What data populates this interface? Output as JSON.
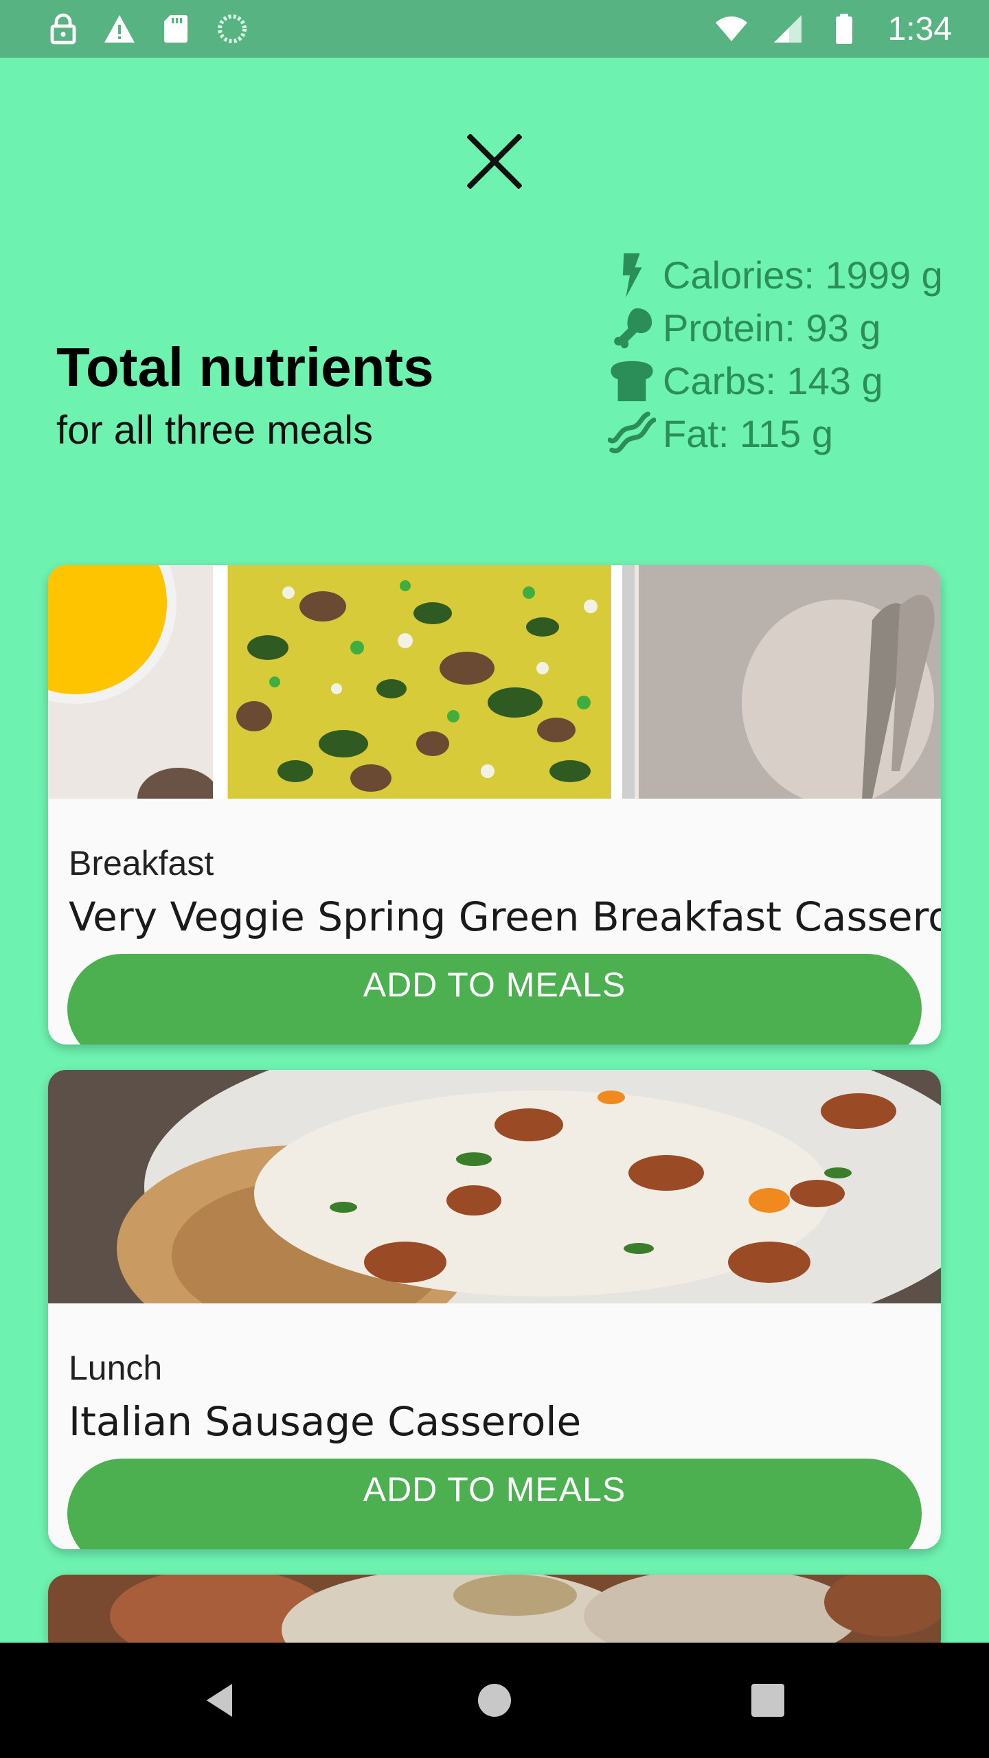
{
  "status_bar": {
    "time": "1:34",
    "left_icons": [
      "lock-icon",
      "warning-icon",
      "sd-card-icon",
      "sync-icon"
    ],
    "right_icons": [
      "wifi-icon",
      "signal-icon",
      "battery-icon"
    ]
  },
  "summary": {
    "title": "Total nutrients",
    "subtitle": "for all three meals",
    "nutrients": [
      {
        "icon": "lightning-icon",
        "text": "Calories: 1999 g"
      },
      {
        "icon": "drumstick-icon",
        "text": "Protein: 93 g"
      },
      {
        "icon": "bread-icon",
        "text": "Carbs: 143 g"
      },
      {
        "icon": "bacon-icon",
        "text": "Fat: 115 g"
      }
    ]
  },
  "meals": [
    {
      "label": "Breakfast",
      "title": "Very Veggie Spring Green Breakfast Casserole",
      "button": "ADD TO MEALS"
    },
    {
      "label": "Lunch",
      "title": "Italian Sausage Casserole",
      "button": "ADD TO MEALS"
    }
  ],
  "colors": {
    "background": "#6ef2b0",
    "status_bar": "#58b382",
    "accent_text": "#2b8d58",
    "button": "#4caf50"
  }
}
